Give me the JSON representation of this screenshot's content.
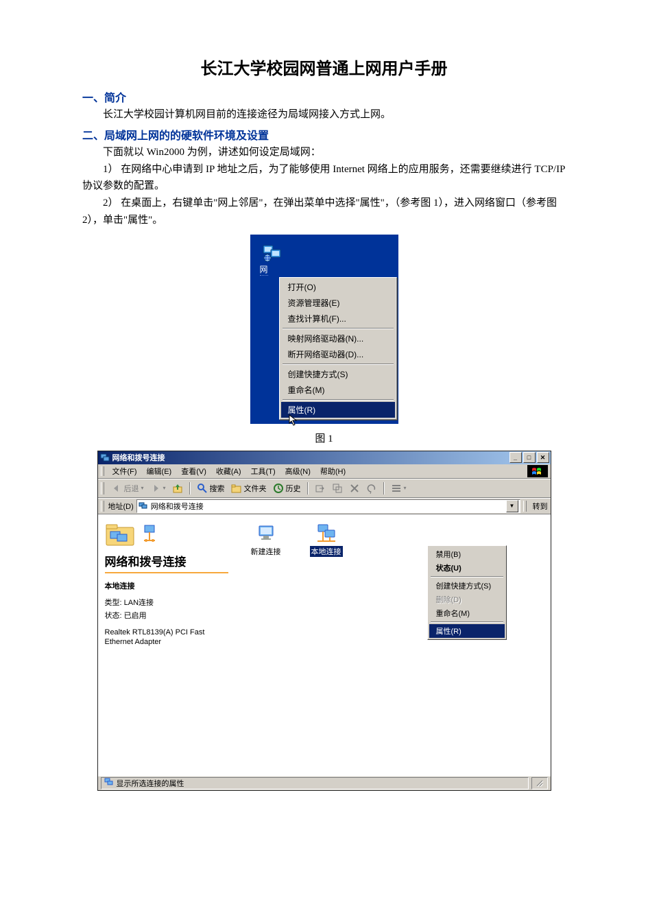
{
  "doc": {
    "title": "长江大学校园网普通上网用户手册",
    "sec1_head": "一、简介",
    "sec1_p1": "长江大学校园计算机网目前的连接途径为局域网接入方式上网。",
    "sec2_head": "二、局域网上网的的硬软件环境及设置",
    "sec2_p1": "下面就以 Win2000 为例，讲述如何设定局域网：",
    "sec2_p2": "1） 在网络中心申请到 IP 地址之后，为了能够使用 Internet 网络上的应用服务，还需要继续进行 TCP/IP 协议参数的配置。",
    "sec2_p3": "2） 在桌面上，右键单击\"网上邻居\"，在弹出菜单中选择\"属性\"，（参考图 1），进入网络窗口（参考图 2），单击\"属性\"。",
    "fig1_caption": "图 1"
  },
  "fig1": {
    "icon_label": "网",
    "menu": {
      "open": "打开(O)",
      "explorer": "资源管理器(E)",
      "find": "查找计算机(F)...",
      "map": "映射网络驱动器(N)...",
      "disconnect": "断开网络驱动器(D)...",
      "shortcut": "创建快捷方式(S)",
      "rename": "重命名(M)",
      "properties": "属性(R)"
    }
  },
  "fig2": {
    "title": "网络和拨号连接",
    "menubar": {
      "file": "文件(F)",
      "edit": "编辑(E)",
      "view": "查看(V)",
      "fav": "收藏(A)",
      "tools": "工具(T)",
      "adv": "高级(N)",
      "help": "帮助(H)"
    },
    "toolbar": {
      "back": "后退",
      "search": "搜索",
      "folders": "文件夹",
      "history": "历史"
    },
    "addr": {
      "label": "地址(D)",
      "value": "网络和拨号连接",
      "go": "转到"
    },
    "left": {
      "folder_title": "网络和拨号连接",
      "sel_name": "本地连接",
      "kv_type_label": "类型:",
      "kv_type_value": "LAN连接",
      "kv_status_label": "状态:",
      "kv_status_value": "已启用",
      "adapter": "Realtek RTL8139(A) PCI Fast Ethernet Adapter"
    },
    "icons": {
      "new_conn": "新建连接",
      "local_conn": "本地连接"
    },
    "ctx": {
      "disable": "禁用(B)",
      "status": "状态(U)",
      "shortcut": "创建快捷方式(S)",
      "delete": "删除(D)",
      "rename": "重命名(M)",
      "properties": "属性(R)"
    },
    "statusbar": "显示所选连接的属性"
  }
}
